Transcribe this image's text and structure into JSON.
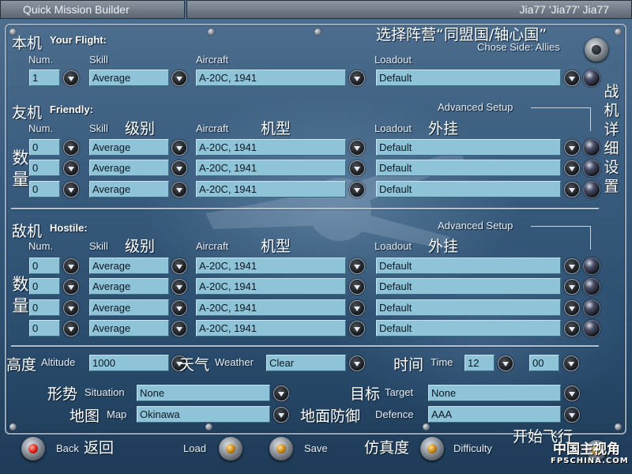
{
  "window": {
    "title": "Quick Mission Builder",
    "user": "Jia77 'Jia77' Jia77"
  },
  "side": {
    "label_cn": "选择阵营“同盟国/轴心国”",
    "label_en": "Chose Side: Allies"
  },
  "your_flight": {
    "title_cn": "本机",
    "title_en": "Your Flight:",
    "headers": {
      "num": "Num.",
      "skill": "Skill",
      "aircraft": "Aircraft",
      "loadout": "Loadout"
    },
    "row": {
      "num": "1",
      "skill": "Average",
      "aircraft": "A-20C, 1941",
      "loadout": "Default"
    }
  },
  "friendly": {
    "title_cn": "友机",
    "title_en": "Friendly:",
    "advanced_setup": "Advanced Setup",
    "headers": {
      "num": "Num.",
      "skill": "Skill",
      "skill_cn": "级别",
      "aircraft": "Aircraft",
      "aircraft_cn": "机型",
      "loadout": "Loadout",
      "loadout_cn": "外挂"
    },
    "qty_cn": "数量",
    "rows": [
      {
        "num": "0",
        "skill": "Average",
        "aircraft": "A-20C, 1941",
        "loadout": "Default"
      },
      {
        "num": "0",
        "skill": "Average",
        "aircraft": "A-20C, 1941",
        "loadout": "Default"
      },
      {
        "num": "0",
        "skill": "Average",
        "aircraft": "A-20C, 1941",
        "loadout": "Default"
      }
    ]
  },
  "side_note_cn": "战机详细设置",
  "hostile": {
    "title_cn": "敌机",
    "title_en": "Hostile:",
    "advanced_setup": "Advanced Setup",
    "headers": {
      "num": "Num.",
      "skill": "Skill",
      "skill_cn": "级别",
      "aircraft": "Aircraft",
      "aircraft_cn": "机型",
      "loadout": "Loadout",
      "loadout_cn": "外挂"
    },
    "qty_cn": "数量",
    "rows": [
      {
        "num": "0",
        "skill": "Average",
        "aircraft": "A-20C, 1941",
        "loadout": "Default"
      },
      {
        "num": "0",
        "skill": "Average",
        "aircraft": "A-20C, 1941",
        "loadout": "Default"
      },
      {
        "num": "0",
        "skill": "Average",
        "aircraft": "A-20C, 1941",
        "loadout": "Default"
      },
      {
        "num": "0",
        "skill": "Average",
        "aircraft": "A-20C, 1941",
        "loadout": "Default"
      }
    ]
  },
  "settings": {
    "altitude": {
      "cn": "高度",
      "en": "Altitude",
      "value": "1000"
    },
    "weather": {
      "cn": "天气",
      "en": "Weather",
      "value": "Clear"
    },
    "time": {
      "cn": "时间",
      "en": "Time",
      "hour": "12",
      "minute": "00"
    },
    "situation": {
      "cn": "形势",
      "en": "Situation",
      "value": "None"
    },
    "target": {
      "cn": "目标",
      "en": "Target",
      "value": "None"
    },
    "map": {
      "cn": "地图",
      "en": "Map",
      "value": "Okinawa"
    },
    "defence": {
      "cn": "地面防御",
      "en": "Defence",
      "value": "AAA"
    }
  },
  "bottom": {
    "back_en": "Back",
    "back_cn": "返回",
    "load": "Load",
    "save": "Save",
    "difficulty_cn": "仿真度",
    "difficulty_en": "Difficulty",
    "start_cn": "开始飞行"
  },
  "watermark": {
    "cn": "中国主视角",
    "en": "FPSCHINA.COM"
  },
  "colors": {
    "field_bg": "#8ec3d8",
    "panel_bg": "#3a5c7e",
    "lamp_red": "#e01810",
    "lamp_amber": "#c8820c"
  }
}
